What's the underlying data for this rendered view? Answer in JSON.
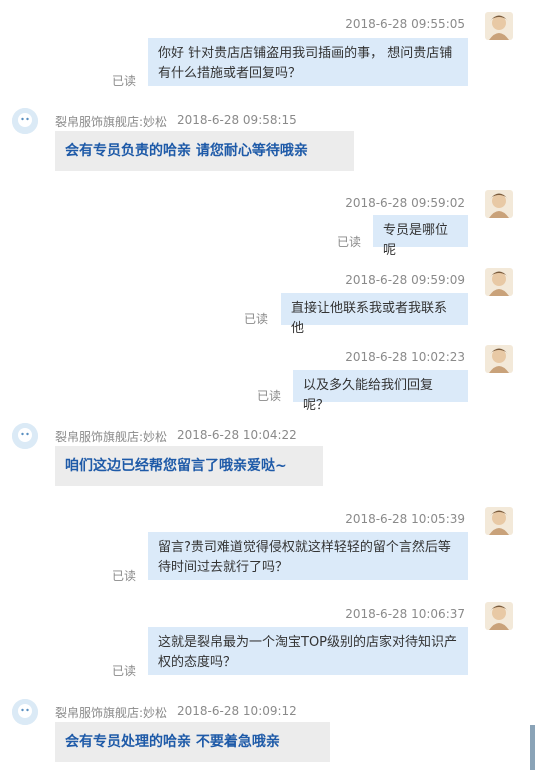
{
  "read_label": "已读",
  "shop_name": "裂帛服饰旗舰店:妙松",
  "messages": [
    {
      "time": "2018-6-28 09:55:05",
      "text": "你好 针对贵店店铺盗用我司插画的事， 想问贵店铺有什么措施或者回复吗？"
    },
    {
      "time": "2018-6-28 09:58:15",
      "text": "会有专员负责的哈亲  请您耐心等待哦亲"
    },
    {
      "time": "2018-6-28 09:59:02",
      "text": "专员是哪位呢"
    },
    {
      "time": "2018-6-28 09:59:09",
      "text": "直接让他联系我或者我联系他"
    },
    {
      "time": "2018-6-28 10:02:23",
      "text": "以及多久能给我们回复呢？"
    },
    {
      "time": "2018-6-28 10:04:22",
      "text": "咱们这边已经帮您留言了哦亲爱哒~"
    },
    {
      "time": "2018-6-28 10:05:39",
      "text": "留言?贵司难道觉得侵权就这样轻轻的留个言然后等待时间过去就行了吗？"
    },
    {
      "time": "2018-6-28 10:06:37",
      "text": "这就是裂帛最为一个淘宝TOP级别的店家对待知识产权的态度吗？"
    },
    {
      "time": "2018-6-28 10:09:12",
      "text": "会有专员处理的哈亲  不要着急哦亲"
    }
  ]
}
